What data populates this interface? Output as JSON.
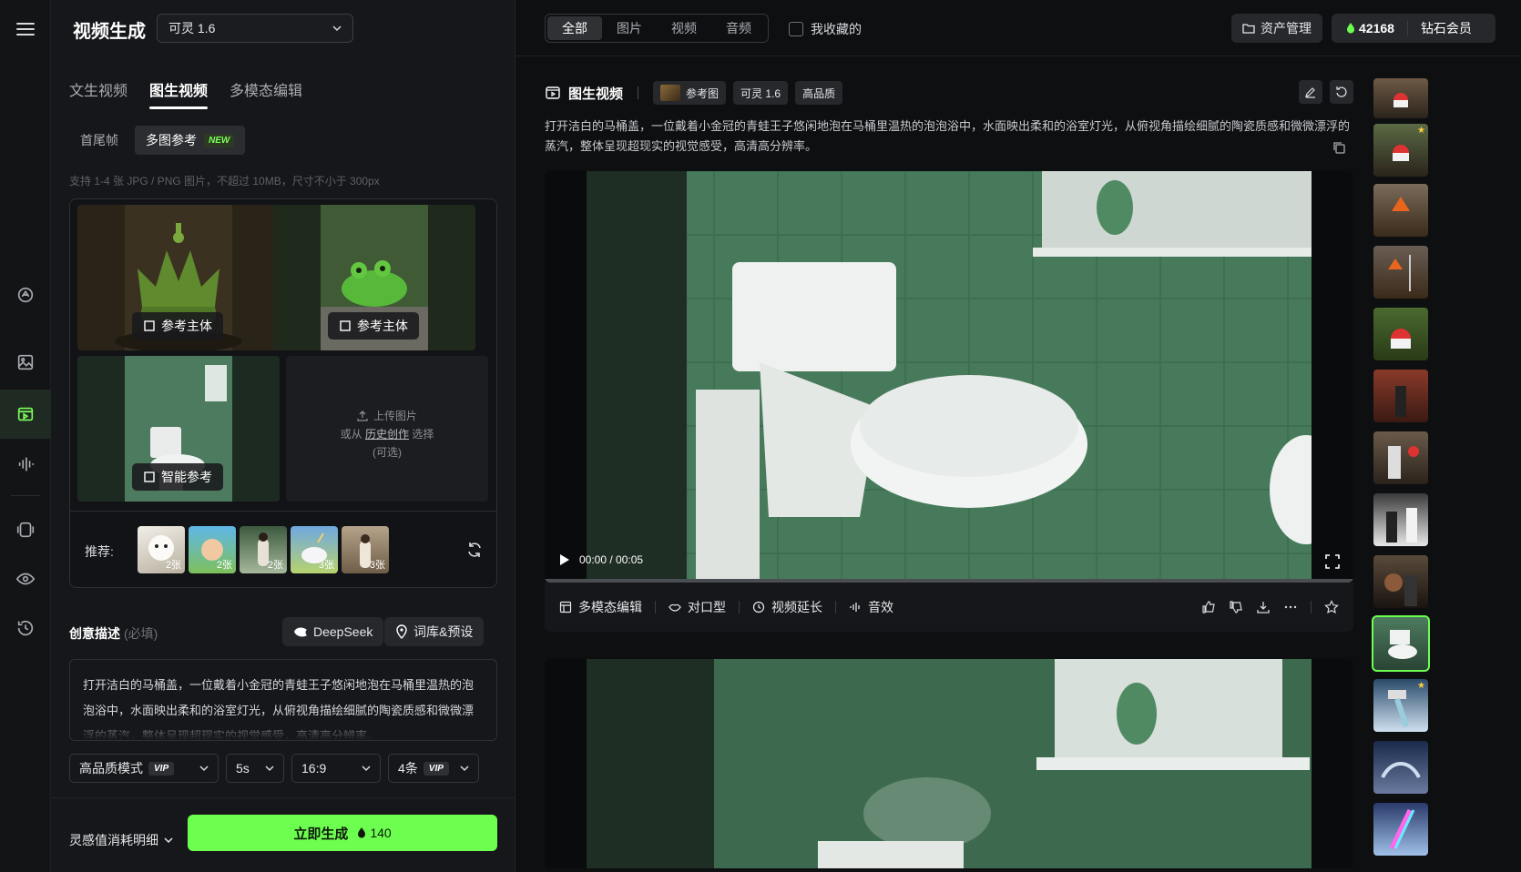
{
  "panel": {
    "title": "视频生成",
    "model": "可灵 1.6",
    "tabs": [
      "文生视频",
      "图生视频",
      "多模态编辑"
    ],
    "subtabs": [
      "首尾帧",
      "多图参考"
    ],
    "new_badge": "NEW",
    "hint": "支持 1-4 张 JPG / PNG 图片，不超过 10MB，尺寸不小于 300px",
    "ref_tags": [
      "参考主体",
      "参考主体",
      "智能参考"
    ],
    "upload": {
      "title": "上传图片",
      "or_from": "或从",
      "history_link": "历史创作",
      "select": "选择",
      "optional": "(可选)"
    },
    "recommend_label": "推荐:",
    "recommend_counts": [
      "2张",
      "2张",
      "2张",
      "3张",
      "3张"
    ],
    "desc_label": "创意描述",
    "desc_required": "(必填)",
    "deepseek_btn": "DeepSeek",
    "presets_btn": "词库&预设",
    "description": "打开洁白的马桶盖，一位戴着小金冠的青蛙王子悠闲地泡在马桶里温热的泡泡浴中，水面映出柔和的浴室灯光，从俯视角描绘细腻的陶瓷质感和微微漂浮的蒸汽，整体呈现超现实的视觉感受，高清高分辨率。",
    "options": {
      "quality": "高品质模式",
      "vip": "VIP",
      "duration": "5s",
      "ratio": "16:9",
      "count": "4条"
    },
    "cost_label": "灵感值消耗明细",
    "generate_label": "立即生成",
    "generate_cost": "140"
  },
  "main": {
    "filters": [
      "全部",
      "图片",
      "视频",
      "音频"
    ],
    "favorites": "我收藏的",
    "asset_btn": "资产管理",
    "points": "42168",
    "membership": "钻石会员",
    "work": {
      "type": "图生视频",
      "chips": [
        "参考图",
        "可灵 1.6",
        "高品质"
      ],
      "prompt": "打开洁白的马桶盖，一位戴着小金冠的青蛙王子悠闲地泡在马桶里温热的泡泡浴中，水面映出柔和的浴室灯光，从俯视角描绘细腻的陶瓷质感和微微漂浮的蒸汽，整体呈现超现实的视觉感受，高清高分辨率。",
      "time": "00:00 / 00:05",
      "progress": 0,
      "tools": [
        "多模态编辑",
        "对口型",
        "视频延长",
        "音效"
      ]
    }
  },
  "colors": {
    "accent": "#6dff4f",
    "bg": "#0e0f11",
    "panel": "#16171a"
  }
}
